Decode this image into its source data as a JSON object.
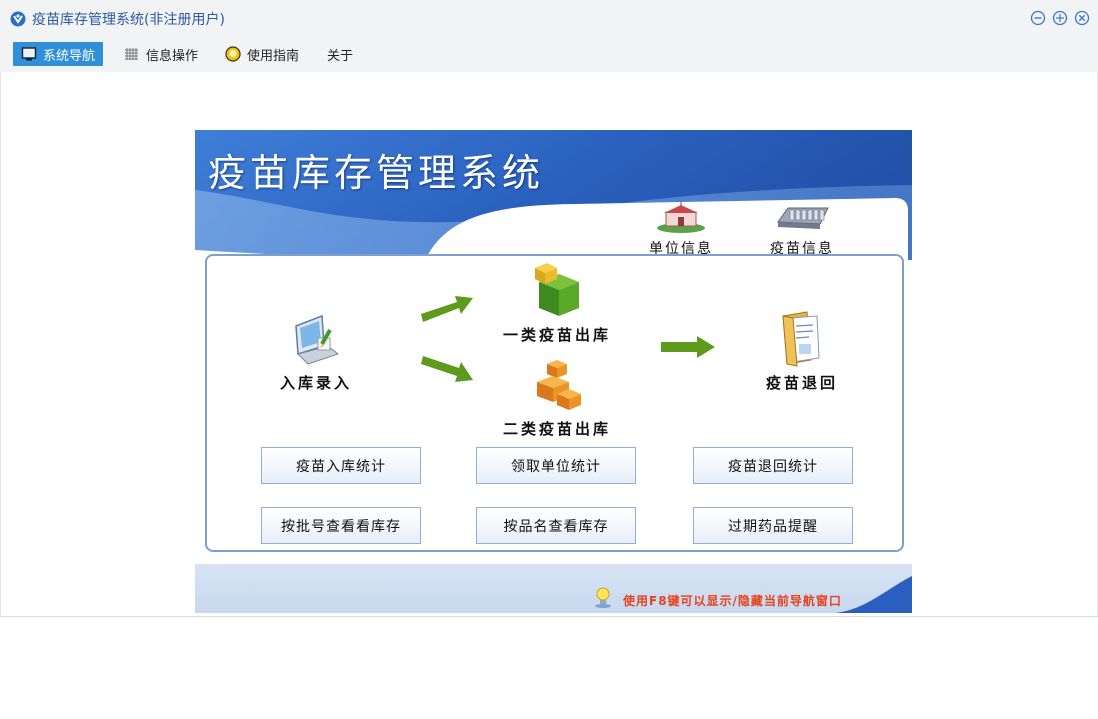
{
  "window": {
    "title": "疫苗库存管理系统(非注册用户)"
  },
  "menu": {
    "items": [
      {
        "label": "系统导航",
        "icon": "monitor-icon",
        "active": true
      },
      {
        "label": "信息操作",
        "icon": "grid-icon",
        "active": false
      },
      {
        "label": "使用指南",
        "icon": "help-icon",
        "active": false
      },
      {
        "label": "关于",
        "icon": "",
        "active": false
      }
    ]
  },
  "panel": {
    "title": "疫苗库存管理系统",
    "top_icons": [
      {
        "label": "单位信息",
        "icon": "building-icon"
      },
      {
        "label": "疫苗信息",
        "icon": "vaccine-tray-icon"
      }
    ],
    "flow": {
      "inbound": "入库录入",
      "class1_out": "一类疫苗出库",
      "class2_out": "二类疫苗出库",
      "return": "疫苗退回"
    },
    "buttons": [
      "疫苗入库统计",
      "领取单位统计",
      "疫苗退回统计",
      "按批号查看看库存",
      "按品名查看库存",
      "过期药品提醒"
    ],
    "tip": "使用F8键可以显示/隐藏当前导航窗口"
  },
  "colors": {
    "accent": "#2f8fd8",
    "title_text": "#2b5aa3",
    "header_blue": "#2a67c8",
    "tip_red": "#e8411c",
    "arrow_green": "#5e9a1c"
  }
}
